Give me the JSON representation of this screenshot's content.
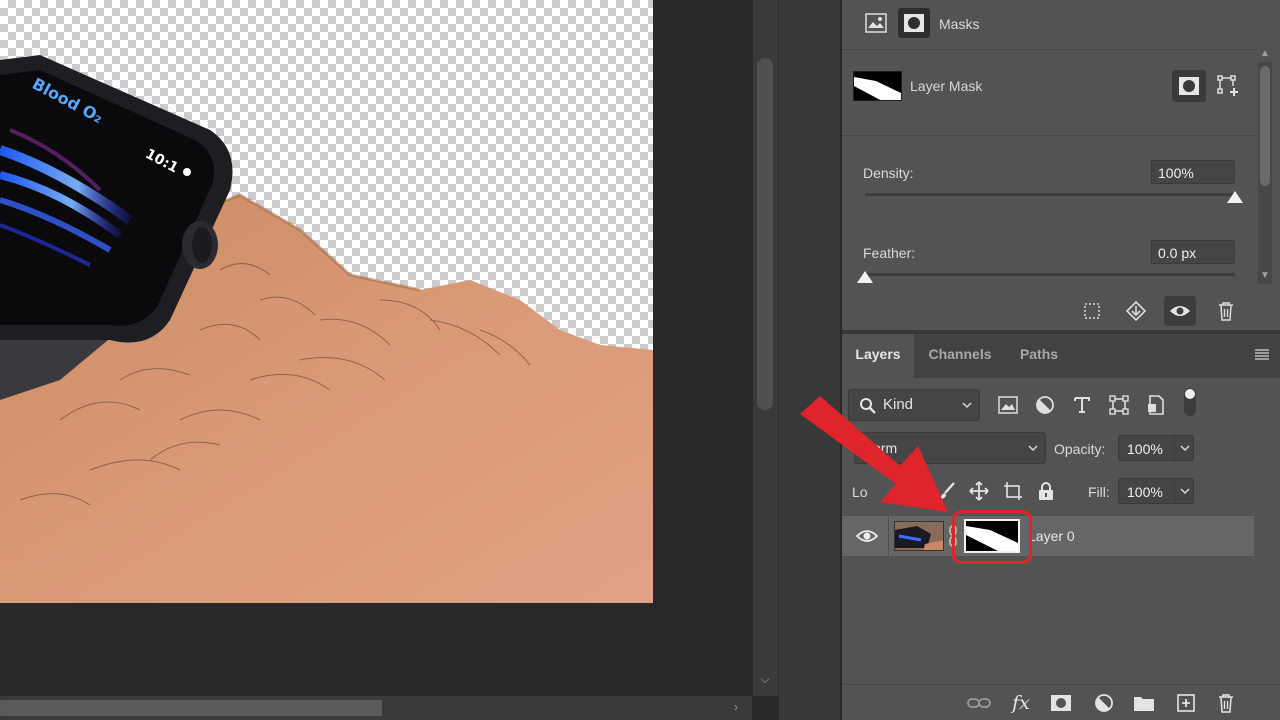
{
  "canvas": {
    "watch_label": "Blood O₂",
    "watch_time": "10:1"
  },
  "properties": {
    "title": "Masks",
    "layer_mask_label": "Layer Mask",
    "density_label": "Density:",
    "density_value": "100%",
    "density_level": 1.0,
    "feather_label": "Feather:",
    "feather_value": "0.0 px",
    "feather_level": 0.0
  },
  "layers_panel": {
    "tabs": [
      {
        "label": "Layers",
        "active": true
      },
      {
        "label": "Channels",
        "active": false
      },
      {
        "label": "Paths",
        "active": false
      }
    ],
    "kind_filter": "Kind",
    "blend_mode": "Norm",
    "opacity_label": "Opacity:",
    "opacity_value": "100%",
    "lock_label": "Lo",
    "fill_label": "Fill:",
    "fill_value": "100%",
    "layers": [
      {
        "name": "Layer 0",
        "visible": true,
        "has_mask": true,
        "selected": true
      }
    ]
  },
  "colors": {
    "panel_bg": "#535353",
    "canvas_bg": "#282828",
    "highlight": "#e0242c",
    "selected_row": "#666666"
  },
  "icons": {
    "properties_header": [
      "pixel-mask-icon",
      "vector-mask-icon"
    ],
    "mask_actions": [
      "add-pixel-mask-icon",
      "add-vector-mask-icon"
    ],
    "properties_footer": [
      "load-selection-icon",
      "apply-mask-icon",
      "eye-icon",
      "trash-icon"
    ],
    "layer_filters": [
      "image-filter-icon",
      "adjustment-filter-icon",
      "type-filter-icon",
      "shape-filter-icon",
      "smart-object-filter-icon"
    ],
    "lock": [
      "lock-pixels-icon",
      "lock-position-icon",
      "lock-artboard-icon",
      "lock-all-icon"
    ],
    "layers_footer": [
      "link-layers-icon",
      "fx-icon",
      "add-mask-icon",
      "adjustment-layer-icon",
      "group-folder-icon",
      "new-layer-icon",
      "delete-layer-icon"
    ]
  }
}
